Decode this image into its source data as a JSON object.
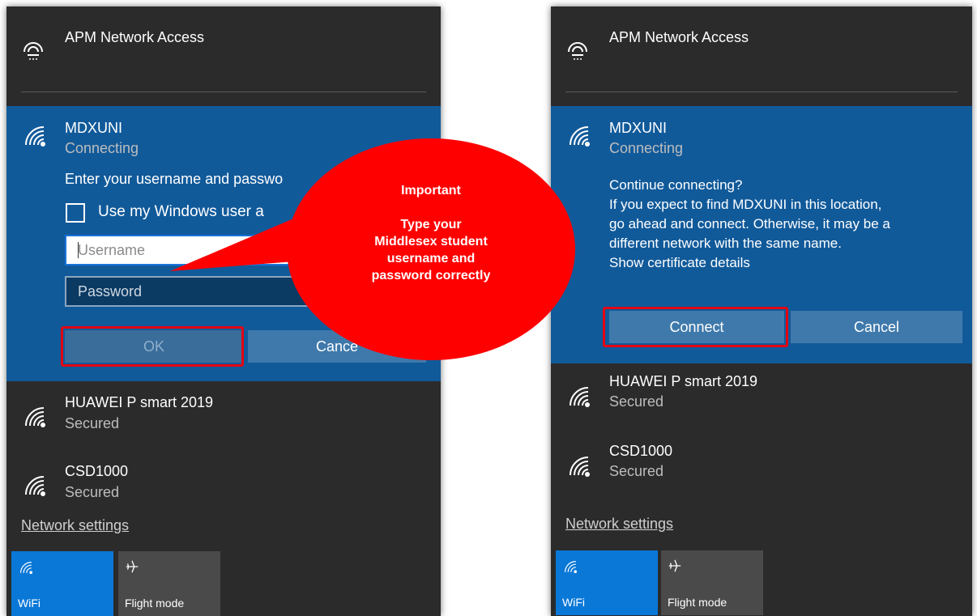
{
  "left": {
    "vpn_title": "APM Network Access",
    "network": {
      "name": "MDXUNI",
      "status": "Connecting"
    },
    "prompt": "Enter your username and passwo",
    "checkbox_label": "Use my Windows user a",
    "username_placeholder": "Username",
    "password_placeholder": "Password",
    "ok_label": "OK",
    "cancel_label": "Cance",
    "others": [
      {
        "name": "HUAWEI P smart 2019",
        "status": "Secured"
      },
      {
        "name": "CSD1000",
        "status": "Secured"
      }
    ],
    "network_settings": "Network settings",
    "tiles": [
      {
        "label": "WiFi",
        "icon": "wifi-icon"
      },
      {
        "label": "Flight mode",
        "icon": "airplane-icon"
      }
    ]
  },
  "right": {
    "vpn_title": "APM Network Access",
    "network": {
      "name": "MDXUNI",
      "status": "Connecting"
    },
    "message": {
      "line1": "Continue connecting?",
      "line2": "If you expect to find MDXUNI in this location,",
      "line3": "go ahead and connect. Otherwise, it may be a",
      "line4": "different network with the same name.",
      "line5": "Show certificate details"
    },
    "connect_label": "Connect",
    "cancel_label": "Cancel",
    "others": [
      {
        "name": "HUAWEI P smart 2019",
        "status": "Secured"
      },
      {
        "name": "CSD1000",
        "status": "Secured"
      }
    ],
    "network_settings": "Network settings",
    "tiles": [
      {
        "label": "WiFi",
        "icon": "wifi-icon"
      },
      {
        "label": "Flight mode",
        "icon": "airplane-icon"
      }
    ]
  },
  "callout": {
    "line1": "Important",
    "line2": "",
    "line3": "Type your",
    "line4": "Middlesex student",
    "line5": "username  and",
    "line6": "password correctly"
  },
  "colors": {
    "panel_bg": "#2b2b2b",
    "expanded_bg": "#115a9a",
    "accent_blue": "#0a78d7",
    "highlight_red": "#e30613"
  }
}
